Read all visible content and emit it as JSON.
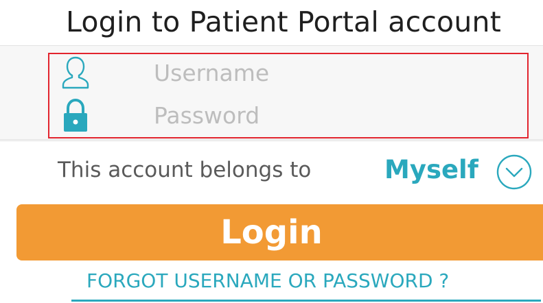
{
  "header": {
    "title": "Login to Patient Portal account"
  },
  "form": {
    "username": {
      "placeholder": "Username",
      "value": "",
      "icon": "user-icon"
    },
    "password": {
      "placeholder": "Password",
      "value": "",
      "icon": "lock-icon"
    },
    "belongs": {
      "label": "This account belongs to",
      "value": "Myself",
      "icon": "chevron-down-icon"
    },
    "login_label": "Login",
    "forgot_label": "FORGOT USERNAME OR PASSWORD ?"
  },
  "colors": {
    "accent": "#2aa8bd",
    "button": "#f29a34",
    "highlight": "#e2242e"
  }
}
